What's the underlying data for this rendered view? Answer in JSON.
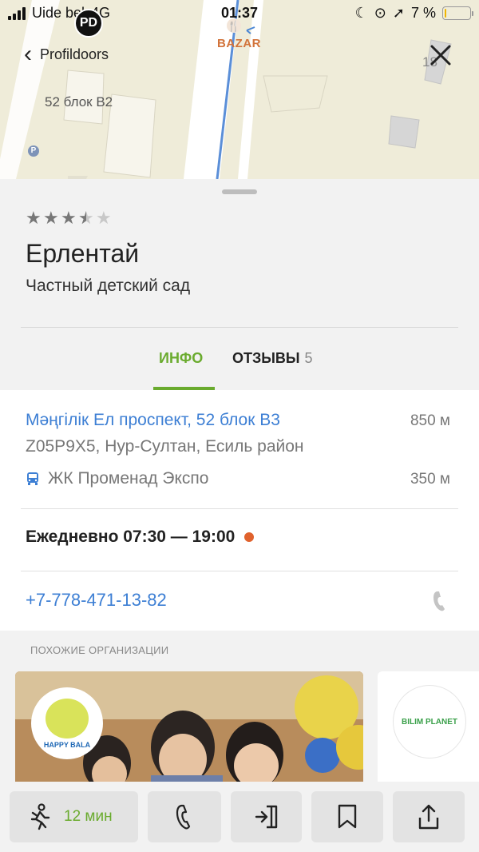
{
  "status_bar": {
    "carrier": "Uide bel",
    "network": "4G",
    "time": "01:37",
    "battery_text": "7 %",
    "battery_level": 0.07
  },
  "map": {
    "badge": "PD",
    "back_label": "Profildoors",
    "building_label": "52 блок В2",
    "poi_label": "BAZAR",
    "edge_number": "18",
    "parking_glyph": "P"
  },
  "place": {
    "rating": 3.5,
    "rating_max": 5,
    "name": "Ерлентай",
    "category": "Частный детский сад"
  },
  "tabs": {
    "info": "ИНФО",
    "reviews": "ОТЗЫВЫ",
    "reviews_count": "5"
  },
  "info": {
    "address": "Мәңгілік Ел проспект, 52 блок В3",
    "address_distance": "850 м",
    "postal": "Z05P9X5, Нур-Султан, Есиль район",
    "transit_stop": "ЖК Променад Экспо",
    "transit_distance": "350 м",
    "hours": "Ежедневно 07:30 — 19:00",
    "phone": "+7-778-471-13-82"
  },
  "similar": {
    "title": "ПОХОЖИЕ ОРГАНИЗАЦИИ",
    "cards": [
      {
        "logo_text": "HAPPY BALA"
      },
      {
        "logo_text": "BILIM PLANET"
      }
    ]
  },
  "bottom_bar": {
    "route_time": "12 мин"
  },
  "colors": {
    "accent_green": "#6aab2e",
    "link_blue": "#3d7fd4",
    "status_dot": "#e0622d"
  }
}
